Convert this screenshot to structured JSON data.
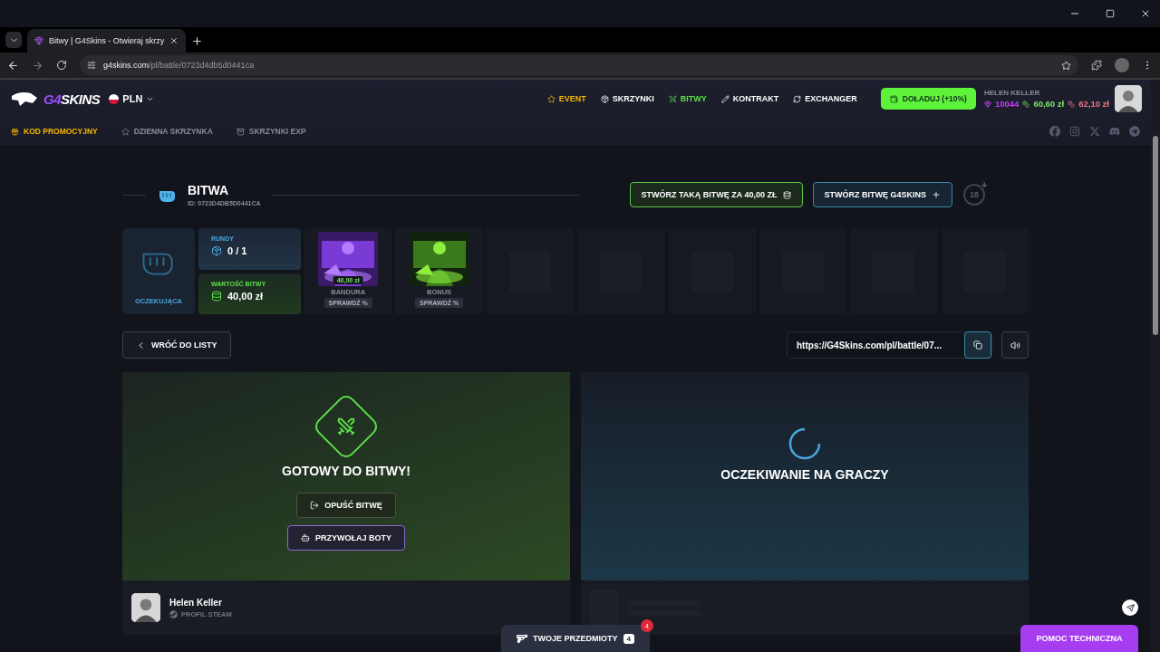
{
  "browser": {
    "tab_title": "Bitwy | G4Skins - Otwieraj skrzy",
    "url_host": "g4skins.com",
    "url_path": "/pl/battle/0723d4db5d0441ca"
  },
  "header": {
    "logo_accent": "G4",
    "logo_rest": "SKINS",
    "currency": "PLN",
    "nav": [
      {
        "label": "EVENT",
        "kind": "event",
        "selected": false
      },
      {
        "label": "SKRZYNKI",
        "kind": "cases",
        "selected": false
      },
      {
        "label": "BITWY",
        "kind": "battles",
        "selected": true
      },
      {
        "label": "KONTRAKT",
        "kind": "contract",
        "selected": false
      },
      {
        "label": "EXCHANGER",
        "kind": "exchanger",
        "selected": false
      }
    ],
    "deposit": "DOŁADUJ (+10%)",
    "user_name": "HELEN KELLER",
    "points": "10044",
    "balance": "60,60 zł",
    "bonus_balance": "62,10 zł",
    "subnav": [
      {
        "label": "KOD PROMOCYJNY",
        "kind": "promo"
      },
      {
        "label": "DZIENNA SKRZYNKA",
        "kind": "daily"
      },
      {
        "label": "SKRZYNKI EXP",
        "kind": "exp"
      }
    ]
  },
  "battle": {
    "title": "BITWA",
    "id": "ID: 0723D4DB5D0441CA",
    "create_same": "STWÓRZ TAKĄ BITWĘ ZA 40,00 ZŁ",
    "create_new": "STWÓRZ BITWĘ G4SKINS",
    "age": "18",
    "age_plus": "+",
    "status": "OCZEKUJĄCA",
    "rounds_label": "RUNDY",
    "rounds": "0 / 1",
    "value_label": "WARTOŚĆ BITWY",
    "value": "40,00 zł",
    "cases": [
      {
        "name": "BANDURA",
        "price": "40,00 zł",
        "check": "SPRAWDŹ %",
        "kind": "purple"
      },
      {
        "name": "BONUS",
        "check": "SPRAWDŹ %",
        "kind": "green"
      }
    ],
    "back": "WRÓĆ DO LISTY",
    "share_url": "https://G4Skins.com/pl/battle/07...",
    "slots": [
      {
        "kind": "ready",
        "title": "GOTOWY DO BITWY!",
        "leave": "OPUŚĆ BITWĘ",
        "bots": "PRZYWOŁAJ BOTY",
        "player": "Helen Keller",
        "profile": "PROFIL STEAM"
      },
      {
        "kind": "waiting",
        "title": "OCZEKIWANIE NA GRACZY"
      }
    ]
  },
  "footer": {
    "inventory": "TWOJE PRZEDMIOTY",
    "inventory_count": "4",
    "notification_count": "4",
    "help": "POMOC TECHNICZNA"
  }
}
